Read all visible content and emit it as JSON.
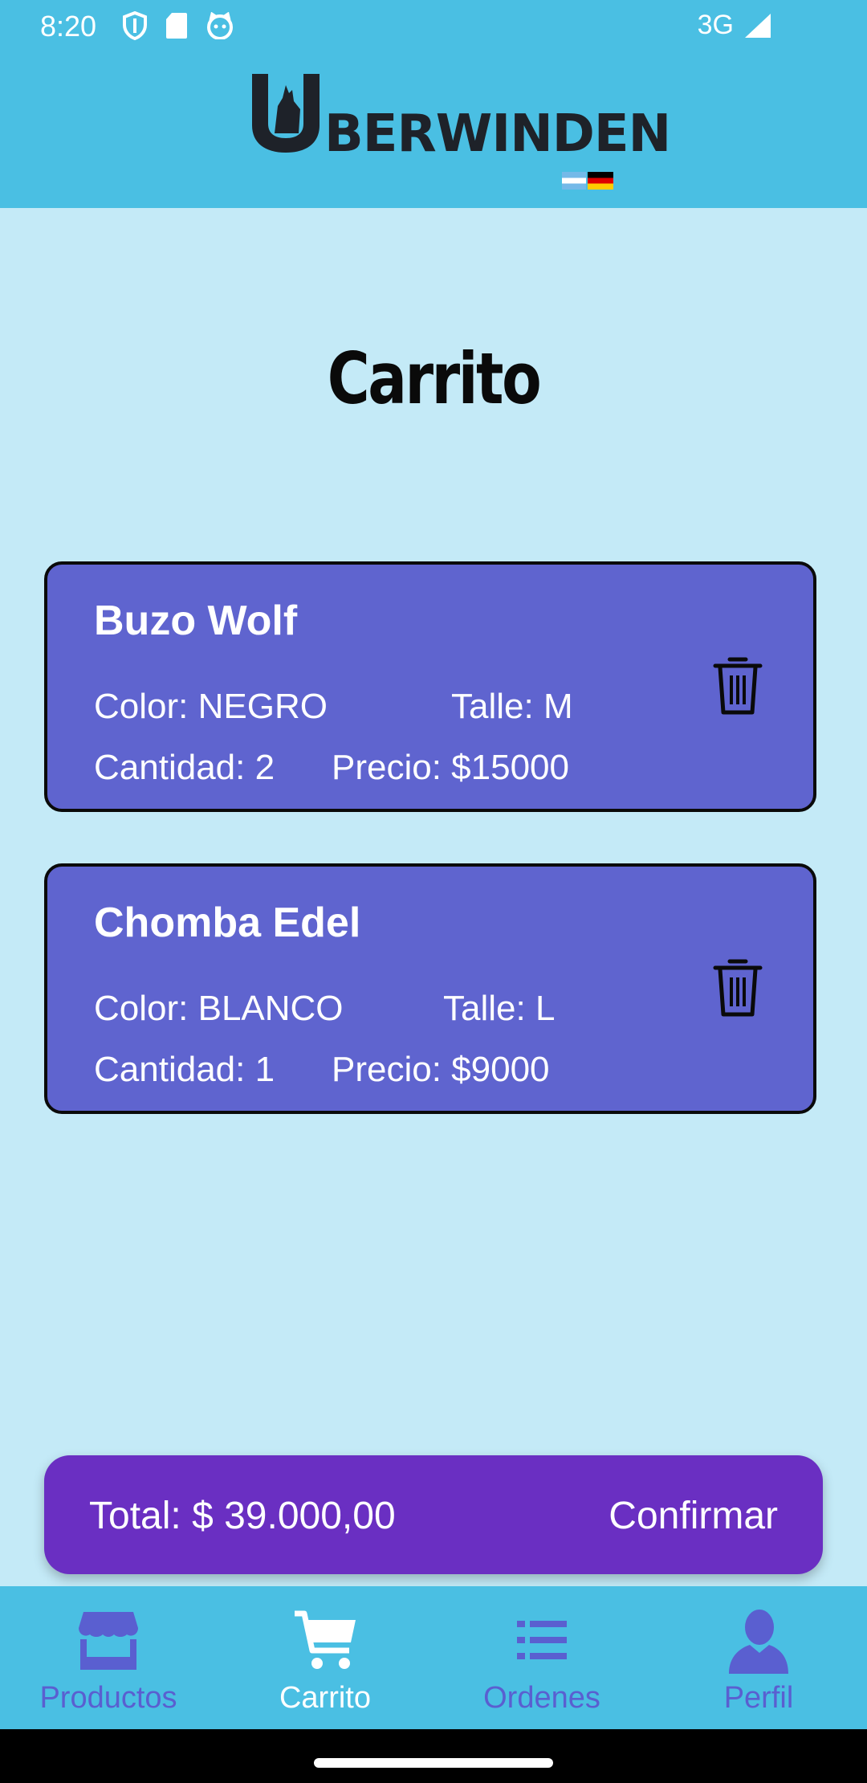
{
  "status_bar": {
    "time": "8:20",
    "network": "3G",
    "icons": [
      "shield-icon",
      "sd-card-icon",
      "cat-icon",
      "signal-icon"
    ]
  },
  "header": {
    "brand": "BERWINDEN",
    "brand_initial_icon": "wolf-u-logo-icon",
    "flags": [
      "argentina-flag",
      "germany-flag"
    ]
  },
  "page": {
    "title": "Carrito"
  },
  "cart": {
    "items": [
      {
        "name": "Buzo Wolf",
        "color": "Color: NEGRO",
        "size": "Talle: M",
        "quantity": "Cantidad: 2",
        "price": "Precio: $15000",
        "delete_icon": "trash-icon"
      },
      {
        "name": "Chomba Edel",
        "color": "Color: BLANCO",
        "size": "Talle: L",
        "quantity": "Cantidad: 1",
        "price": "Precio: $9000",
        "delete_icon": "trash-icon"
      }
    ],
    "total_label": "Total: $ 39.000,00",
    "confirm_label": "Confirmar"
  },
  "bottom_nav": {
    "items": [
      {
        "label": "Productos",
        "icon": "store-icon",
        "active": false
      },
      {
        "label": "Carrito",
        "icon": "cart-icon",
        "active": true
      },
      {
        "label": "Ordenes",
        "icon": "list-icon",
        "active": false
      },
      {
        "label": "Perfil",
        "icon": "person-icon",
        "active": false
      }
    ]
  },
  "colors": {
    "header": "#4abfe3",
    "background": "#c4eaf7",
    "card": "#5f64cf",
    "total_bar": "#6a2fc2",
    "nav_inactive": "#5a5fd0",
    "nav_active": "#ffffff"
  }
}
